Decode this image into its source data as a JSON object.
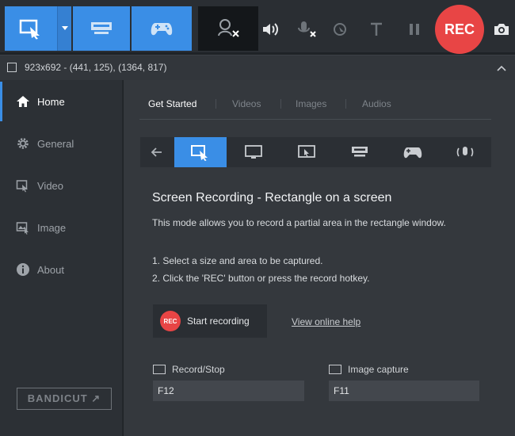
{
  "toolbar": {
    "rec_label": "REC"
  },
  "status": {
    "info": "923x692 - (441, 125), (1364, 817)"
  },
  "sidebar": {
    "items": [
      {
        "label": "Home",
        "icon": "home-icon",
        "active": true
      },
      {
        "label": "General",
        "icon": "gear-icon",
        "active": false
      },
      {
        "label": "Video",
        "icon": "video-icon",
        "active": false
      },
      {
        "label": "Image",
        "icon": "image-icon",
        "active": false
      },
      {
        "label": "About",
        "icon": "info-icon",
        "active": false
      }
    ],
    "logo": "BANDICUT ↗"
  },
  "main": {
    "tabs": [
      {
        "label": "Get Started",
        "active": true
      },
      {
        "label": "Videos",
        "active": false
      },
      {
        "label": "Images",
        "active": false
      },
      {
        "label": "Audios",
        "active": false
      }
    ],
    "heading": "Screen Recording - Rectangle on a screen",
    "description": "This mode allows you to record a partial area in the rectangle window.",
    "steps": [
      "1. Select a size and area to be captured.",
      "2. Click the 'REC' button or press the record hotkey."
    ],
    "start_button": "Start recording",
    "start_badge": "REC",
    "help_link": "View online help",
    "hotkeys": {
      "record_stop_label": "Record/Stop",
      "record_stop_value": "F12",
      "image_capture_label": "Image capture",
      "image_capture_value": "F11"
    }
  },
  "colors": {
    "accent": "#3a8ee6",
    "rec": "#e84545"
  }
}
